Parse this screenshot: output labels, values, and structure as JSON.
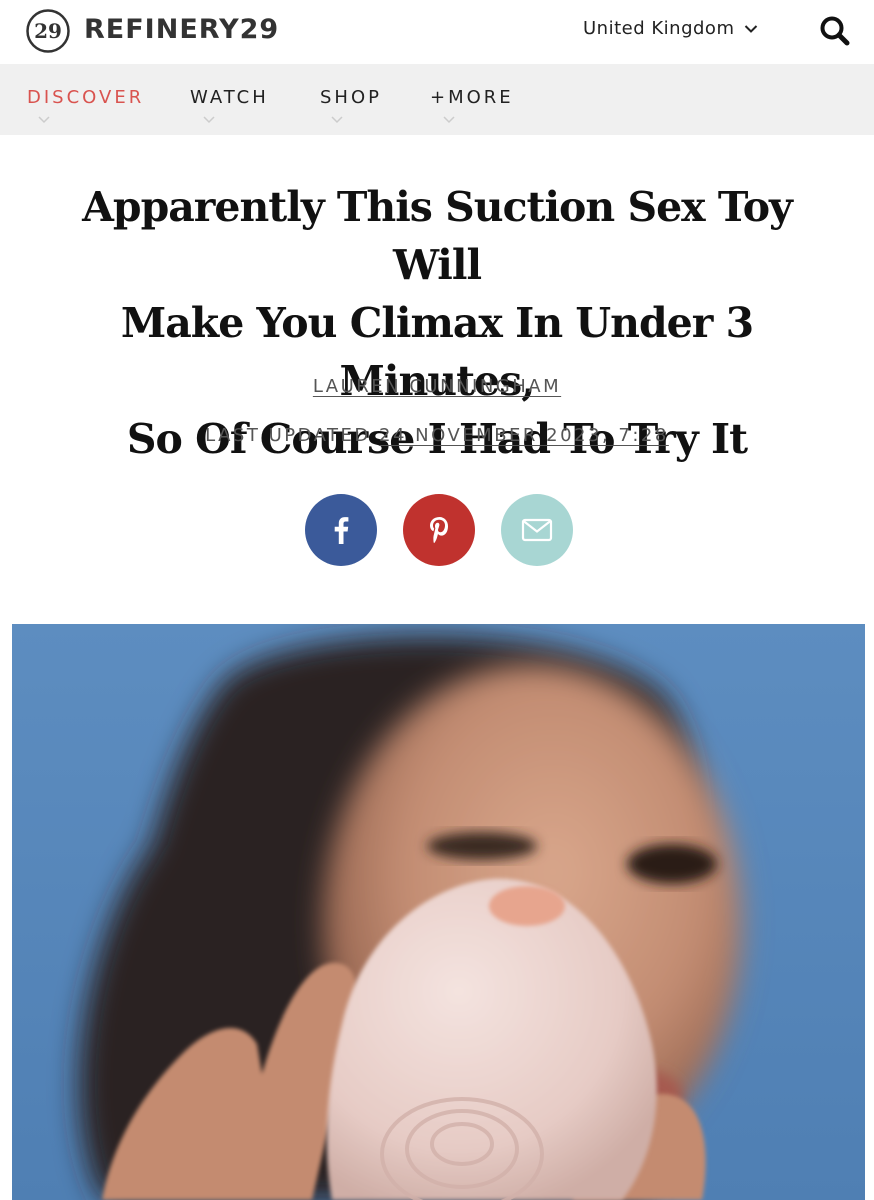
{
  "header": {
    "brand": "REFINERY29",
    "logo_glyph": "29",
    "region": "United Kingdom"
  },
  "nav": {
    "items": [
      {
        "label": "DISCOVER",
        "active": true
      },
      {
        "label": "WATCH",
        "active": false
      },
      {
        "label": "SHOP",
        "active": false
      },
      {
        "label": "+MORE",
        "active": false
      }
    ]
  },
  "article": {
    "headline_lines": [
      "Apparently This Suction Sex Toy Will",
      "Make You Climax In Under 3 Minutes,",
      "So Of Course I Had To Try It"
    ],
    "author": "LAUREN CUNNINGHAM",
    "updated_prefix": "LAST UPDATED",
    "updated_date": "24 NOVEMBER 2023, 7:28"
  },
  "share": {
    "facebook_glyph": "f",
    "icons": [
      "facebook-icon",
      "pinterest-icon",
      "email-icon"
    ]
  },
  "colors": {
    "accent": "#d9534f",
    "facebook": "#3b5a9a",
    "pinterest": "#c0322e",
    "email": "#a8d6d3",
    "nav_bg": "#f0f0f0"
  }
}
